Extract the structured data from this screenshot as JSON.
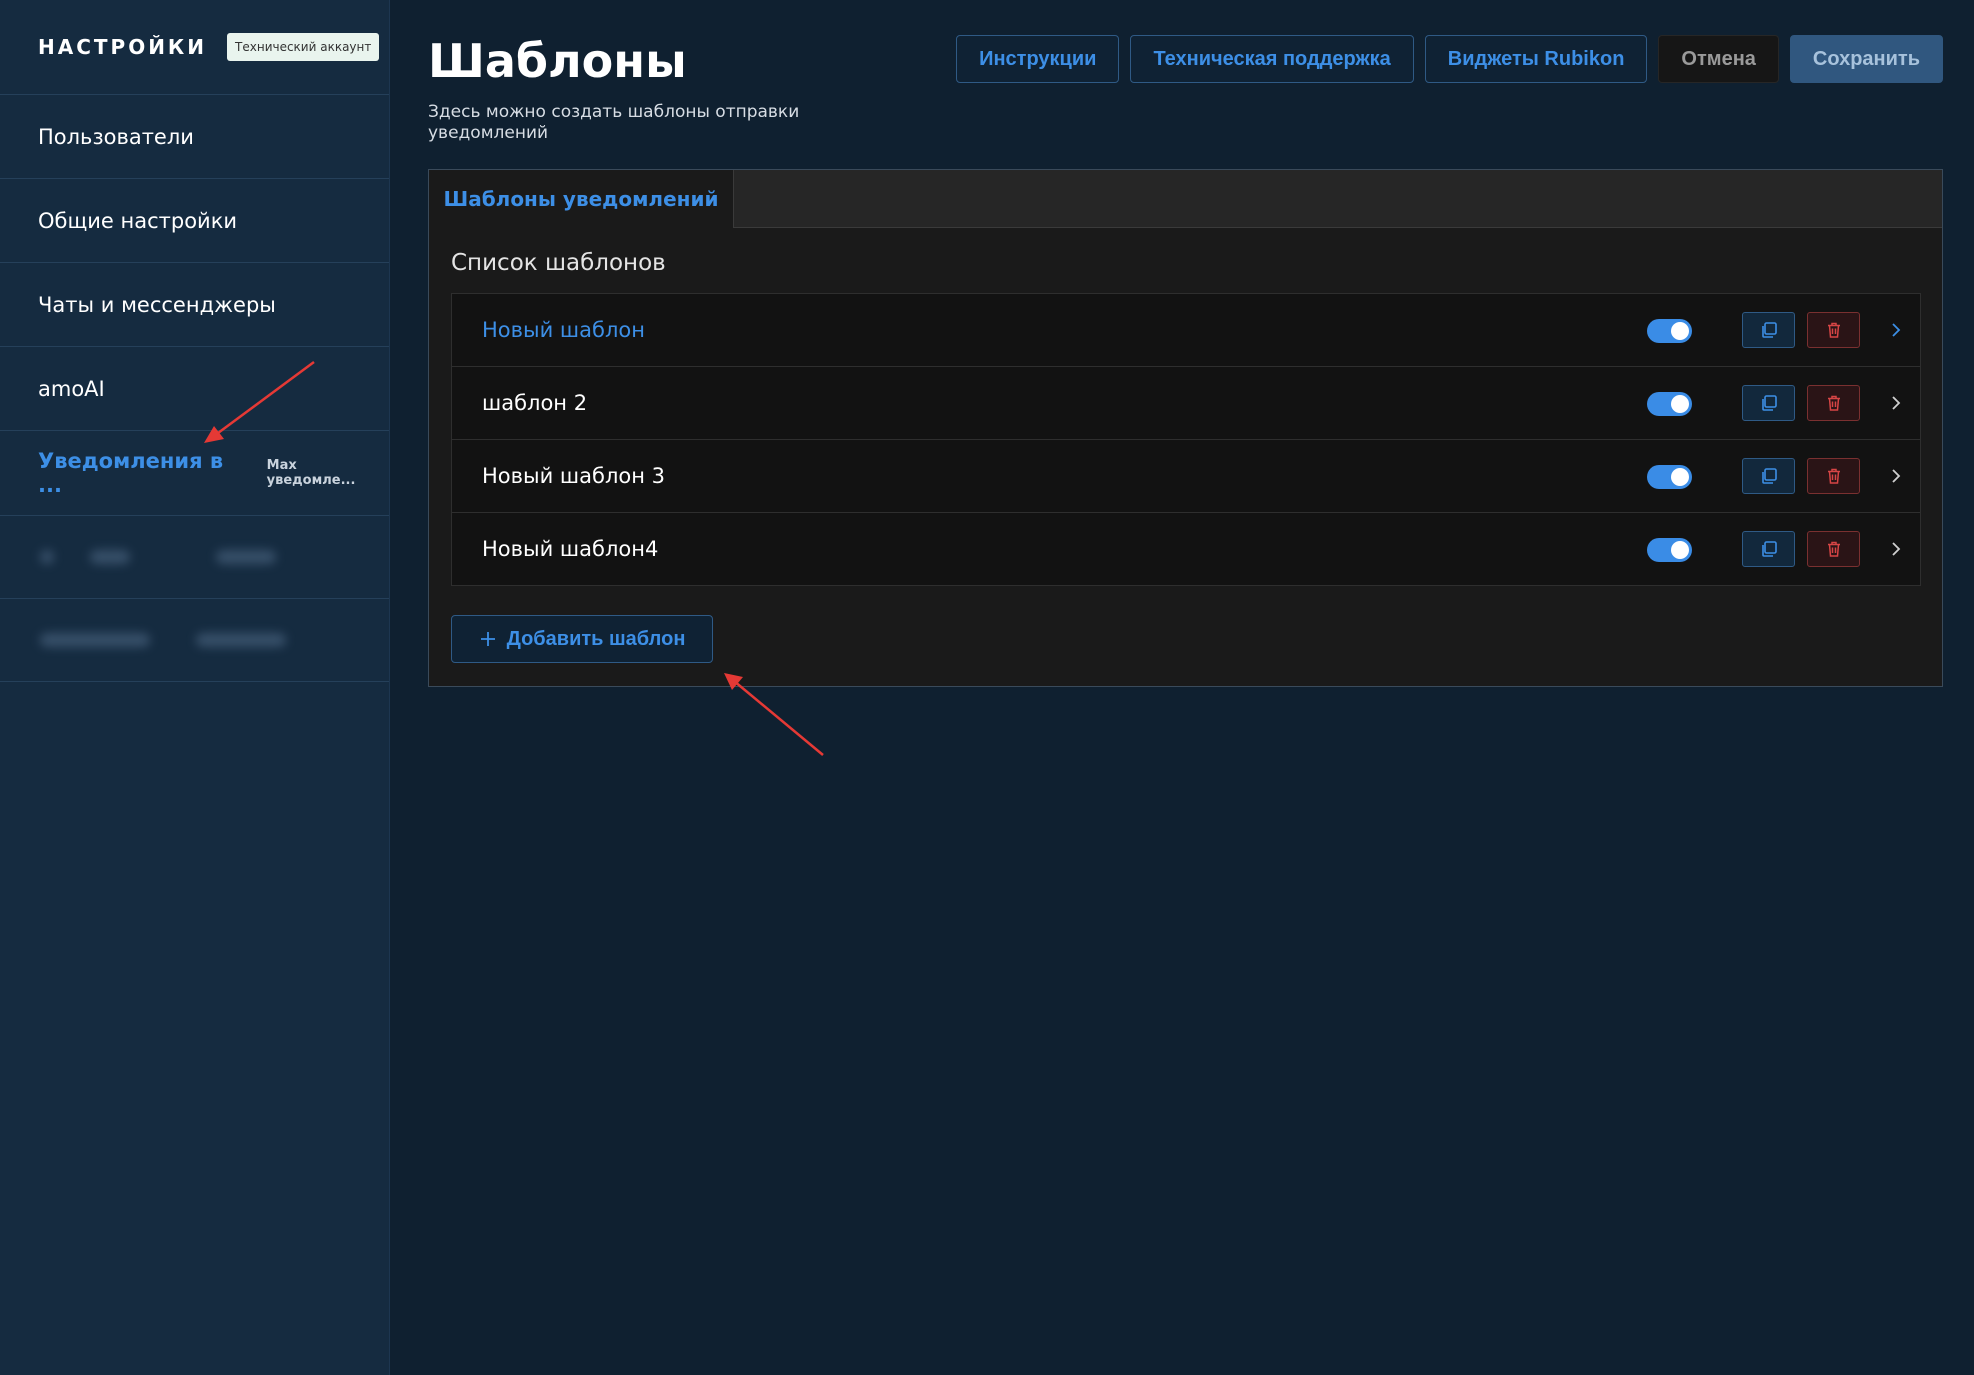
{
  "sidebar": {
    "title": "НАСТРОЙКИ",
    "badge": "Технический аккаунт",
    "items": [
      {
        "label": "Пользователи"
      },
      {
        "label": "Общие настройки"
      },
      {
        "label": "Чаты и мессенджеры"
      },
      {
        "label": "amoAI"
      },
      {
        "label": "Уведомления в ...",
        "sub": "Max уведомле..."
      }
    ]
  },
  "header": {
    "title": "Шаблоны",
    "description": "Здесь можно создать шаблоны отправки уведомлений"
  },
  "toolbar": {
    "instructions": "Инструкции",
    "support": "Техническая поддержка",
    "widgets": "Виджеты Rubikon",
    "cancel": "Отмена",
    "save": "Сохранить"
  },
  "tabs": [
    {
      "label": "Шаблоны уведомлений",
      "active": true
    }
  ],
  "list": {
    "title": "Список шаблонов",
    "rows": [
      {
        "name": "Новый шаблон",
        "enabled": true,
        "active": true
      },
      {
        "name": "шаблон 2",
        "enabled": true
      },
      {
        "name": "Новый шаблон 3",
        "enabled": true
      },
      {
        "name": "Новый шаблон4",
        "enabled": true
      }
    ]
  },
  "add_button": "Добавить шаблон",
  "colors": {
    "accent": "#3d8fe6",
    "danger": "#d64545",
    "annotation_arrow": "#e53935"
  }
}
